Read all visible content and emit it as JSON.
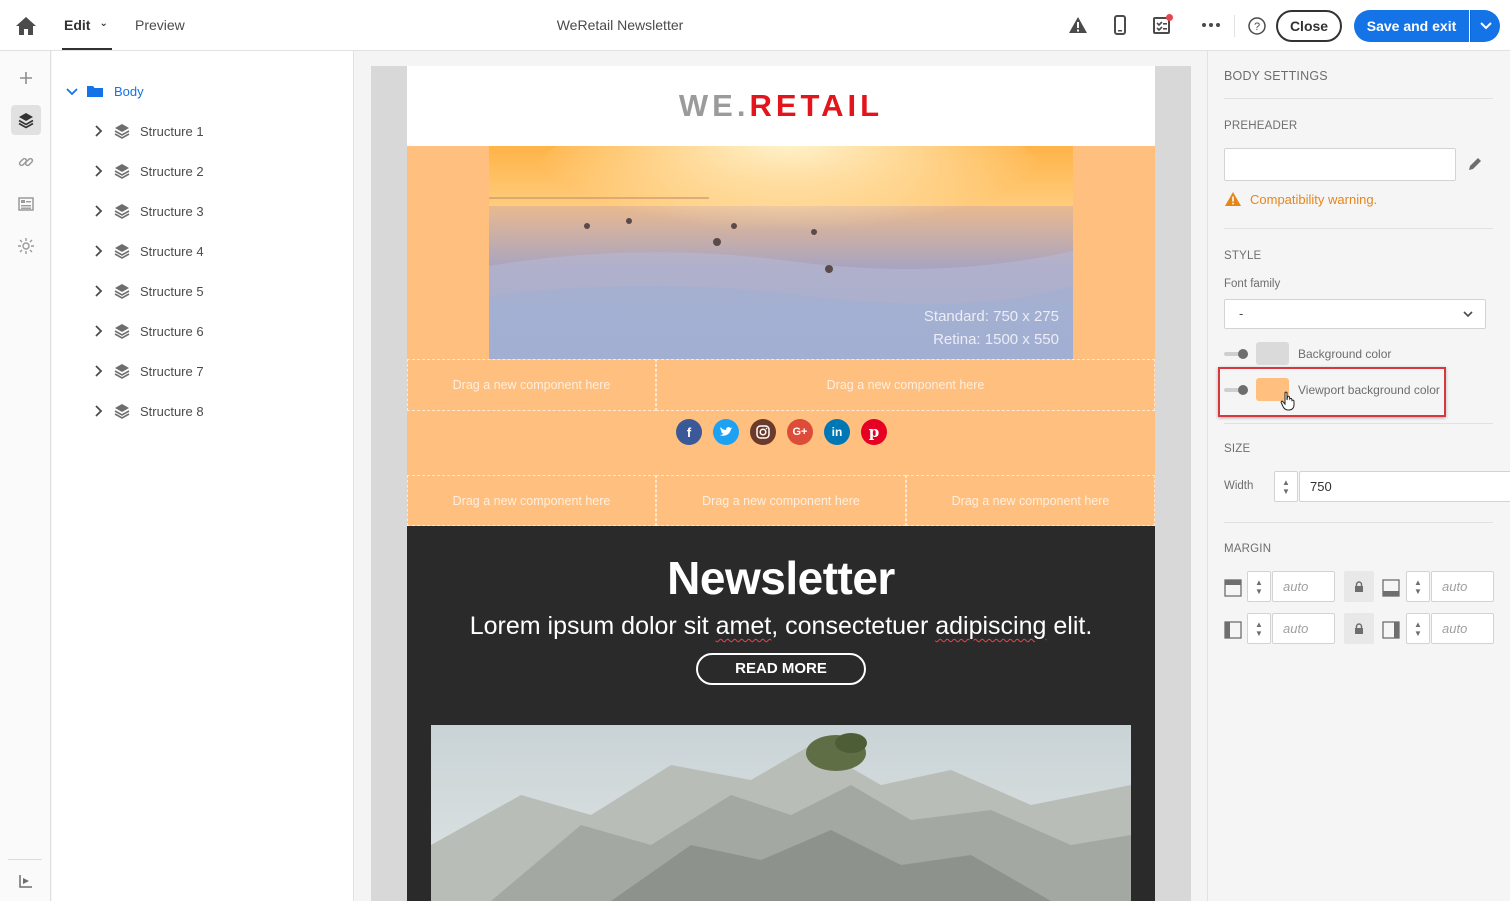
{
  "header": {
    "tabs": [
      {
        "label": "Edit",
        "active": true
      },
      {
        "label": "Preview",
        "active": false
      }
    ],
    "title": "WeRetail Newsletter",
    "icons": [
      "warning-icon",
      "mobile-icon",
      "checklist-icon",
      "more-icon",
      "help-icon"
    ],
    "close_label": "Close",
    "save_label": "Save and exit"
  },
  "rail": {
    "items": [
      "add-icon",
      "layers-icon",
      "link-icon",
      "assets-icon",
      "fragments-icon",
      "structure-settings-icon"
    ],
    "active": "layers-icon"
  },
  "tree": {
    "root": "Body",
    "items": [
      "Structure 1",
      "Structure 2",
      "Structure 3",
      "Structure 4",
      "Structure 5",
      "Structure 6",
      "Structure 7",
      "Structure 8"
    ]
  },
  "email": {
    "logo_we": "WE.",
    "logo_retail": "RETAIL",
    "hero_dim_line1": "Standard: 750 x 275",
    "hero_dim_line2": "Retina: 1500 x 550",
    "dropzone_label": "Drag a new component here",
    "social": [
      "facebook",
      "twitter",
      "instagram",
      "google-plus",
      "linkedin",
      "pinterest"
    ],
    "newsletter_title": "Newsletter",
    "subtitle_parts": [
      "Lorem ipsum dolor sit ",
      "amet",
      ", consectetuer ",
      "adipiscing",
      " elit."
    ],
    "read_more": "READ MORE",
    "band_color": "#ffbf7e"
  },
  "panel": {
    "title": "BODY SETTINGS",
    "preheader_heading": "PREHEADER",
    "preheader_value": "",
    "warning": "Compatibility warning.",
    "style_heading": "STYLE",
    "font_family_label": "Font family",
    "font_family_value": "-",
    "background_color_label": "Background color",
    "background_color": "#dadada",
    "viewport_color_label": "Viewport background color",
    "viewport_color": "#ffbf7e",
    "size_heading": "SIZE",
    "width_label": "Width",
    "width_value": "750",
    "margin_heading": "MARGIN",
    "margin_placeholder": "auto"
  }
}
